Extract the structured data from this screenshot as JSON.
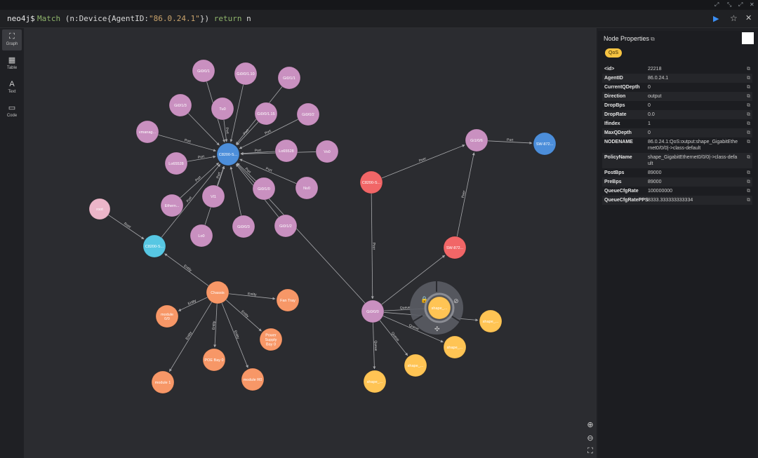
{
  "window": {
    "controls": [
      "⤢",
      "⤡",
      "⤢",
      "✕"
    ]
  },
  "editor": {
    "prompt": "neo4j$",
    "query_parts": [
      {
        "t": "Match ",
        "c": "kw"
      },
      {
        "t": "(n:Device{AgentID:",
        "c": "var"
      },
      {
        "t": "\"86.0.24.1\"",
        "c": "str"
      },
      {
        "t": "}) ",
        "c": "var"
      },
      {
        "t": "return ",
        "c": "kw"
      },
      {
        "t": "n",
        "c": "var"
      }
    ],
    "run_icon": "▶",
    "favorite_icon": "☆",
    "close_icon": "✕"
  },
  "nav": [
    {
      "label": "Graph",
      "icon": "⛶",
      "active": true
    },
    {
      "label": "Table",
      "icon": "▦",
      "active": false
    },
    {
      "label": "Text",
      "icon": "A",
      "active": false
    },
    {
      "label": "Code",
      "icon": "▭",
      "active": false
    }
  ],
  "colors": {
    "purple": "#c990c0",
    "blue": "#4c8eda",
    "cyan": "#57c7e3",
    "red": "#f16667",
    "orange": "#f79767",
    "yellow": "#ffc454",
    "pink": "#ecb5c9"
  },
  "graph": {
    "nodes": [
      {
        "id": "n1",
        "label": "Gi0/0/1",
        "color": "purple"
      },
      {
        "id": "n2",
        "label": "Gi0/0/1.10",
        "color": "purple"
      },
      {
        "id": "n3",
        "label": "Gi0/1/1",
        "color": "purple"
      },
      {
        "id": "n4",
        "label": "Gi0/1/3",
        "color": "purple"
      },
      {
        "id": "n5",
        "label": "Tu0",
        "color": "purple"
      },
      {
        "id": "n6",
        "label": "Gi0/0/1.15",
        "color": "purple"
      },
      {
        "id": "n7",
        "label": "Gi0/0/2",
        "color": "purple"
      },
      {
        "id": "n8",
        "label": "vmanag...",
        "color": "purple"
      },
      {
        "id": "c1",
        "label": "C8200-S...",
        "color": "blue"
      },
      {
        "id": "n9",
        "label": "Lo65528",
        "color": "purple"
      },
      {
        "id": "n10",
        "label": "Vo0",
        "color": "purple"
      },
      {
        "id": "n11",
        "label": "Lo65528",
        "color": "purple"
      },
      {
        "id": "n12",
        "label": "Gi0/1/0",
        "color": "purple"
      },
      {
        "id": "n13",
        "label": "Nv0",
        "color": "purple"
      },
      {
        "id": "n14",
        "label": "Vl1",
        "color": "purple"
      },
      {
        "id": "n15",
        "label": "Ethern...",
        "color": "purple"
      },
      {
        "id": "n16",
        "label": "Lo0",
        "color": "purple"
      },
      {
        "id": "n17",
        "label": "Gi0/0/3",
        "color": "purple"
      },
      {
        "id": "n18",
        "label": "Gi0/1/2",
        "color": "purple"
      },
      {
        "id": "root",
        "label": "root",
        "color": "pink"
      },
      {
        "id": "cy",
        "label": "C8200-S...",
        "color": "cyan"
      },
      {
        "id": "ch",
        "label": "Chassis",
        "color": "orange"
      },
      {
        "id": "o1",
        "label": "Fan Tray",
        "color": "orange"
      },
      {
        "id": "o2",
        "label": "module 0/0",
        "color": "orange"
      },
      {
        "id": "o3",
        "label": "Power Supply Bay 0",
        "color": "orange"
      },
      {
        "id": "o4",
        "label": "POE Bay 0",
        "color": "orange"
      },
      {
        "id": "o5",
        "label": "module 1",
        "color": "orange"
      },
      {
        "id": "o6",
        "label": "module R0",
        "color": "orange"
      },
      {
        "id": "r1",
        "label": "C8200-S...",
        "color": "red"
      },
      {
        "id": "g1",
        "label": "Gi1/0/6",
        "color": "purple"
      },
      {
        "id": "b2",
        "label": "SW-872...",
        "color": "blue"
      },
      {
        "id": "r2",
        "label": "SW-872...",
        "color": "red"
      },
      {
        "id": "g0",
        "label": "Gi0/0/0",
        "color": "purple"
      },
      {
        "id": "y1",
        "label": "shape_...",
        "color": "yellow",
        "selected": true
      },
      {
        "id": "y2",
        "label": "shape_...",
        "color": "yellow"
      },
      {
        "id": "y3",
        "label": "shape_...",
        "color": "yellow"
      },
      {
        "id": "y4",
        "label": "shape_...",
        "color": "yellow"
      },
      {
        "id": "y5",
        "label": "shape_...",
        "color": "yellow"
      }
    ],
    "edges": [
      {
        "from": "n1",
        "to": "c1",
        "label": ""
      },
      {
        "from": "n2",
        "to": "c1",
        "label": ""
      },
      {
        "from": "n3",
        "to": "c1",
        "label": ""
      },
      {
        "from": "n4",
        "to": "c1",
        "label": ""
      },
      {
        "from": "n5",
        "to": "c1",
        "label": "Port"
      },
      {
        "from": "n6",
        "to": "c1",
        "label": "Port"
      },
      {
        "from": "n7",
        "to": "c1",
        "label": "Port"
      },
      {
        "from": "n8",
        "to": "c1",
        "label": "Port"
      },
      {
        "from": "n9",
        "to": "c1",
        "label": "Port"
      },
      {
        "from": "n10",
        "to": "c1",
        "label": "Port"
      },
      {
        "from": "n11",
        "to": "c1",
        "label": "Port"
      },
      {
        "from": "n12",
        "to": "c1",
        "label": "Port"
      },
      {
        "from": "n13",
        "to": "c1",
        "label": "Port"
      },
      {
        "from": "n14",
        "to": "c1",
        "label": "Port"
      },
      {
        "from": "n15",
        "to": "c1",
        "label": "Port"
      },
      {
        "from": "n16",
        "to": "c1",
        "label": ""
      },
      {
        "from": "n17",
        "to": "c1",
        "label": ""
      },
      {
        "from": "n18",
        "to": "c1",
        "label": ""
      },
      {
        "from": "cy",
        "to": "c1",
        "label": "Port"
      },
      {
        "from": "root",
        "to": "cy",
        "label": "Root"
      },
      {
        "from": "ch",
        "to": "cy",
        "label": "Entity"
      },
      {
        "from": "ch",
        "to": "o1",
        "label": "Entity"
      },
      {
        "from": "ch",
        "to": "o2",
        "label": "Entity"
      },
      {
        "from": "ch",
        "to": "o3",
        "label": "Entity"
      },
      {
        "from": "ch",
        "to": "o4",
        "label": "Entity"
      },
      {
        "from": "ch",
        "to": "o5",
        "label": "Entity"
      },
      {
        "from": "ch",
        "to": "o6",
        "label": "Entity"
      },
      {
        "from": "r1",
        "to": "g1",
        "label": "Peer"
      },
      {
        "from": "g1",
        "to": "b2",
        "label": "Port"
      },
      {
        "from": "r2",
        "to": "g1",
        "label": "Peer"
      },
      {
        "from": "r1",
        "to": "g0",
        "label": "Peer"
      },
      {
        "from": "g0",
        "to": "c1",
        "label": ""
      },
      {
        "from": "g0",
        "to": "r2",
        "label": ""
      },
      {
        "from": "g0",
        "to": "y1",
        "label": "Queue"
      },
      {
        "from": "g0",
        "to": "y2",
        "label": "Queue"
      },
      {
        "from": "g0",
        "to": "y3",
        "label": "Queue"
      },
      {
        "from": "g0",
        "to": "y4",
        "label": "Queue"
      },
      {
        "from": "g0",
        "to": "y5",
        "label": "Queue"
      }
    ]
  },
  "zoom": {
    "in_icon": "⊕",
    "out_icon": "⊖",
    "fit_icon": "⛶"
  },
  "panel": {
    "title": "Node Properties",
    "copy_icon": "⧉",
    "label": "QoS",
    "properties": [
      {
        "key": "<id>",
        "value": "22218"
      },
      {
        "key": "AgentID",
        "value": "86.0.24.1"
      },
      {
        "key": "CurrentQDepth",
        "value": "0"
      },
      {
        "key": "Direction",
        "value": "output"
      },
      {
        "key": "DropBps",
        "value": "0"
      },
      {
        "key": "DropRate",
        "value": "0.0"
      },
      {
        "key": "Ifindex",
        "value": "1"
      },
      {
        "key": "MaxQDepth",
        "value": "0"
      },
      {
        "key": "NODENAME",
        "value": "86.0.24.1:QoS:output:shape_GigabitEthernet0/0/0|->class-default"
      },
      {
        "key": "PolicyName",
        "value": "shape_GigabitEthernet0/0/0|->class-default"
      },
      {
        "key": "PostBps",
        "value": "89000"
      },
      {
        "key": "PreBps",
        "value": "89000"
      },
      {
        "key": "QueueCfgRate",
        "value": "100000000"
      },
      {
        "key": "QueueCfgRatePPS",
        "value": "8333.333333333334"
      }
    ]
  }
}
